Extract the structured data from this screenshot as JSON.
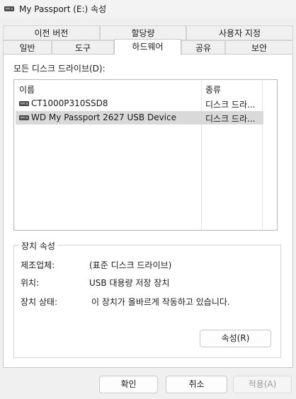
{
  "window": {
    "title": "My Passport (E:) 속성",
    "icon": "drive-icon"
  },
  "tabs": {
    "row_top": [
      {
        "label": "이전 버전"
      },
      {
        "label": "할당량"
      },
      {
        "label": "사용자 지정"
      }
    ],
    "row_bottom": [
      {
        "label": "일반"
      },
      {
        "label": "도구"
      },
      {
        "label": "하드웨어",
        "active": true
      },
      {
        "label": "공유"
      },
      {
        "label": "보안"
      }
    ]
  },
  "drives": {
    "label": "모든 디스크 드라이브(D):",
    "columns": {
      "name": "이름",
      "type": "종류"
    },
    "rows": [
      {
        "name": "CT1000P310SSD8",
        "type": "디스크 드라..."
      },
      {
        "name": "WD My Passport 2627 USB Device",
        "type": "디스크 드라...",
        "selected": true
      }
    ]
  },
  "device_properties": {
    "title": "장치 속성",
    "manufacturer_label": "제조업체:",
    "manufacturer_value": "(표준 디스크 드라이브)",
    "location_label": "위치:",
    "location_value": "USB 대용량 저장 장치",
    "status_label": "장치 상태:",
    "status_value": "이 장치가 올바르게 작동하고 있습니다.",
    "properties_button": "속성(R)"
  },
  "footer": {
    "ok": "확인",
    "cancel": "취소",
    "apply": "적용(A)"
  }
}
